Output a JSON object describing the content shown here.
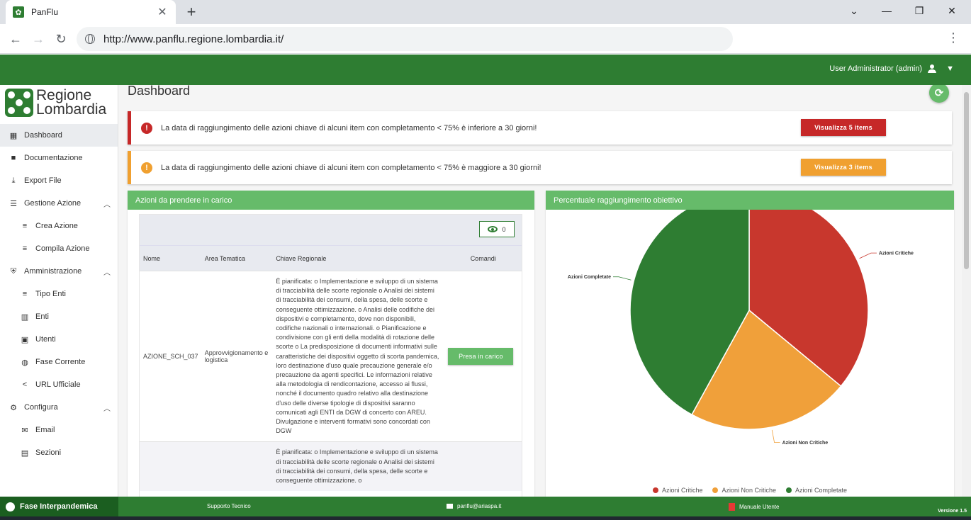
{
  "browser": {
    "tab_title": "PanFlu",
    "url": "http://www.panflu.regione.lombardia.it/"
  },
  "header": {
    "user": "User Administrator (admin)"
  },
  "logo": {
    "line1": "Regione",
    "line2": "Lombardia"
  },
  "sidebar": {
    "items": [
      {
        "label": "Dashboard",
        "icon": "dashboard-icon"
      },
      {
        "label": "Documentazione",
        "icon": "folder-icon"
      },
      {
        "label": "Export File",
        "icon": "download-icon"
      },
      {
        "label": "Gestione Azione",
        "icon": "list-icon"
      },
      {
        "label": "Crea Azione",
        "icon": "search-list-icon"
      },
      {
        "label": "Compila Azione",
        "icon": "search-list-icon"
      },
      {
        "label": "Amministrazione",
        "icon": "admin-shield-icon"
      },
      {
        "label": "Tipo Enti",
        "icon": "playlist-check-icon"
      },
      {
        "label": "Enti",
        "icon": "building-icon"
      },
      {
        "label": "Utenti",
        "icon": "user-box-icon"
      },
      {
        "label": "Fase Corrente",
        "icon": "globe-icon"
      },
      {
        "label": "URL Ufficiale",
        "icon": "share-icon"
      },
      {
        "label": "Configura",
        "icon": "gear-icon"
      },
      {
        "label": "Email",
        "icon": "mail-icon"
      },
      {
        "label": "Sezioni",
        "icon": "sections-icon"
      }
    ]
  },
  "main": {
    "title": "Dashboard",
    "alerts": [
      {
        "text": "La data di raggiungimento delle azioni chiave di alcuni item con completamento < 75% è inferiore a 30 giorni!",
        "button": "Visualizza 5 items",
        "color": "#c62828"
      },
      {
        "text": "La data di raggiungimento delle azioni chiave di alcuni item con completamento < 75% è maggiore a 30 giorni!",
        "button": "Visualizza 3 items",
        "color": "#f0a030"
      }
    ],
    "actions_panel": {
      "title": "Azioni da prendere in carico",
      "view_count": "0",
      "columns": [
        "Nome",
        "Area Tematica",
        "Chiave Regionale",
        "Comandi"
      ],
      "rows": [
        {
          "nome": "AZIONE_SCH_037",
          "area": "Approvvigionamento e logistica",
          "chiave": "È pianificata: o Implementazione e sviluppo di un sistema di tracciabilità delle scorte regionale o Analisi dei sistemi di tracciabilità dei consumi, della spesa, delle scorte e conseguente ottimizzazione. o Analisi delle codifiche dei dispositivi e completamento, dove non disponibili, codifiche nazionali o internazionali. o Pianificazione e condivisione con gli enti della modalità di rotazione delle scorte o La predisposizione di documenti informativi sulle caratteristiche dei dispositivi oggetto di scorta pandemica, loro destinazione d'uso quale precauzione generale e/o precauzione da agenti specifici. Le informazioni relative alla metodologia di rendicontazione, accesso ai flussi, nonché il documento quadro relativo alla destinazione d'uso delle diverse tipologie di dispositivi saranno comunicati agli ENTI da DGW di concerto con AREU. Divulgazione e interventi formativi sono concordati con DGW",
          "button": "Presa in carico"
        },
        {
          "nome": "",
          "area": "",
          "chiave": "È pianificata: o Implementazione e sviluppo di un sistema di tracciabilità delle scorte regionale o Analisi dei sistemi di tracciabilità dei consumi, della spesa, delle scorte e conseguente ottimizzazione. o",
          "button": ""
        }
      ]
    },
    "chart_panel": {
      "title": "Percentuale raggiungimento obiettivo"
    }
  },
  "chart_data": {
    "type": "pie",
    "title": "",
    "categories": [
      "Azioni Critiche",
      "Azioni Non Critiche",
      "Azioni Completate"
    ],
    "values": [
      36,
      22,
      42
    ],
    "colors": [
      "#c8372d",
      "#f0a03a",
      "#2e7d32"
    ],
    "legend": "bottom"
  },
  "footer": {
    "phase": "Fase Interpandemica",
    "support": "Supporto Tecnico",
    "email": "panflu@ariaspa.it",
    "manual": "Manuale Utente",
    "version": "Versione 1.5"
  }
}
